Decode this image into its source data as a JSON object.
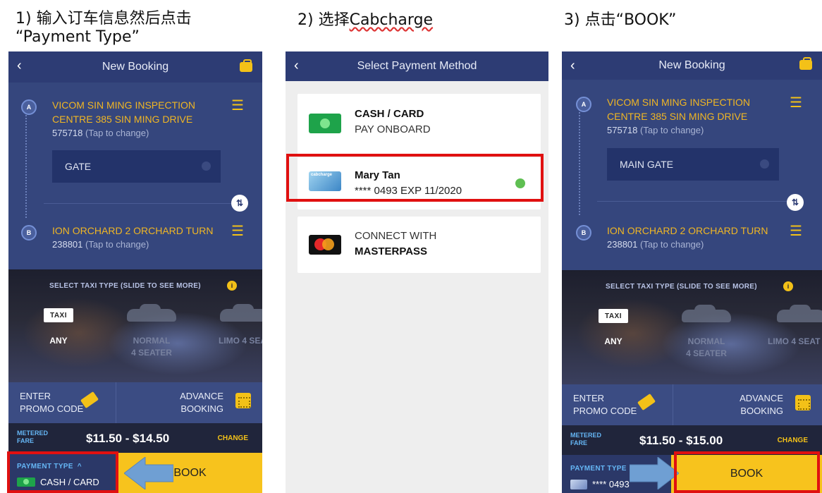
{
  "captions": {
    "step1_line1": "1) 输入订车信息然后点击",
    "step1_line2": "“Payment Type”",
    "step2_prefix": "2) 选择",
    "step2_word": "Cabcharge",
    "step3": "3) 点击“BOOK”"
  },
  "screen1": {
    "title": "New Booking",
    "back": "‹",
    "pickup_marker": "A",
    "pickup_line1": "VICOM SIN MING INSPECTION",
    "pickup_line2": "CENTRE 385 SIN MING DRIVE",
    "pickup_postal": "575718",
    "tap_hint": "(Tap to change)",
    "gate": "GATE",
    "dropoff_marker": "B",
    "dropoff_line1": "ION ORCHARD 2 ORCHARD TURN",
    "dropoff_postal": "238801",
    "swap": "⇅",
    "select_taxi": "SELECT TAXI TYPE (SLIDE TO SEE MORE)",
    "info": "i",
    "taxi_sign": "TAXI",
    "type_any": "ANY",
    "type_normal_1": "NORMAL",
    "type_normal_2": "4 SEATER",
    "type_limo": "LIMO 4 SEA",
    "promo_1": "ENTER",
    "promo_2": "PROMO CODE",
    "advance_1": "ADVANCE",
    "advance_2": "BOOKING",
    "metered_1": "METERED",
    "metered_2": "FARE",
    "fare": "$11.50 - $14.50",
    "change": "CHANGE",
    "payment_label": "PAYMENT TYPE",
    "payment_caret": "^",
    "payment_value": "CASH / CARD",
    "book": "BOOK"
  },
  "screen2": {
    "title": "Select Payment Method",
    "back": "‹",
    "opt1_line1": "CASH / CARD",
    "opt1_line2": "PAY ONBOARD",
    "opt2_line1": "Mary Tan",
    "opt2_line2": "**** 0493  EXP 11/2020",
    "opt2_logo": "cabcharge",
    "opt3_line1": "CONNECT WITH",
    "opt3_line2": "MASTERPASS"
  },
  "screen3": {
    "title": "New Booking",
    "back": "‹",
    "pickup_marker": "A",
    "pickup_line1": "VICOM SIN MING INSPECTION",
    "pickup_line2": "CENTRE 385 SIN MING DRIVE",
    "pickup_postal": "575718",
    "tap_hint": "(Tap to change)",
    "gate": "MAIN GATE",
    "dropoff_marker": "B",
    "dropoff_line1": "ION ORCHARD 2 ORCHARD TURN",
    "dropoff_postal": "238801",
    "swap": "⇅",
    "select_taxi": "SELECT TAXI TYPE (SLIDE TO SEE MORE)",
    "info": "i",
    "taxi_sign": "TAXI",
    "type_any": "ANY",
    "type_normal_1": "NORMAL",
    "type_normal_2": "4 SEATER",
    "type_limo": "LIMO 4 SEAT",
    "promo_1": "ENTER",
    "promo_2": "PROMO CODE",
    "advance_1": "ADVANCE",
    "advance_2": "BOOKING",
    "metered_1": "METERED",
    "metered_2": "FARE",
    "fare": "$11.50 - $15.00",
    "change": "CHANGE",
    "payment_label": "PAYMENT TYPE",
    "payment_value": "**** 0493",
    "book": "BOOK"
  },
  "colors": {
    "navy": "#33447a",
    "gold": "#f7c31d",
    "highlight_red": "#e01010",
    "arrow_blue": "#6f9fd3"
  }
}
